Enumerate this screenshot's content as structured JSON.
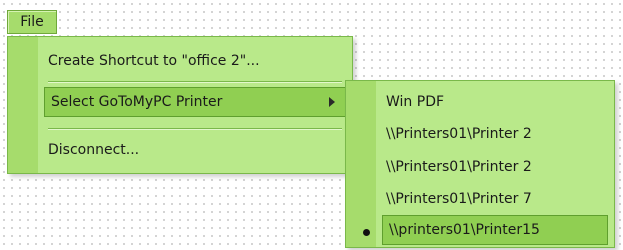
{
  "menubar": {
    "file_label": "File"
  },
  "main_menu": {
    "items": [
      {
        "label": "Create Shortcut to \"office 2\"..."
      },
      {
        "label": "Select GoToMyPC Printer"
      },
      {
        "label": "Disconnect..."
      }
    ]
  },
  "printer_submenu": {
    "items": [
      {
        "label": "Win PDF"
      },
      {
        "label": "\\\\Printers01\\Printer 2"
      },
      {
        "label": "\\\\Printers01\\Printer 2"
      },
      {
        "label": "\\\\Printers01\\Printer 7"
      },
      {
        "label": "\\\\printers01\\Printer15"
      }
    ],
    "selected_index": 4
  }
}
